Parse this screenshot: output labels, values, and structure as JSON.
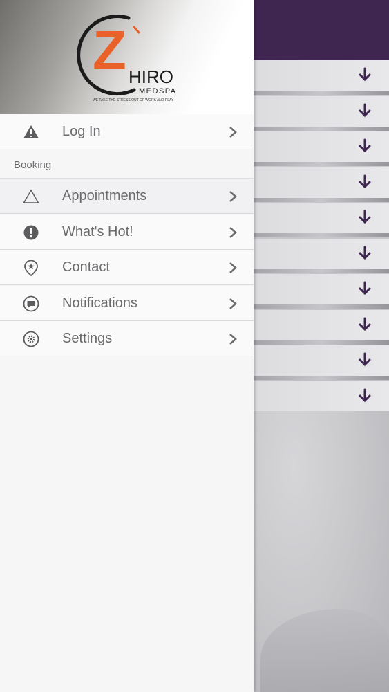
{
  "brand": {
    "letter": "Z",
    "name_rest": "HIRO",
    "sub": "MEDSPA",
    "tagline": "WE TAKE THE STRESS OUT OF WORK AND PLAY",
    "accent_color": "#e8622a",
    "header_color": "#3f2650"
  },
  "menu": {
    "login": {
      "label": "Log In",
      "icon": "warning-icon"
    },
    "section": "Booking",
    "items": [
      {
        "label": "Appointments",
        "icon": "triangle-icon"
      },
      {
        "label": "What's Hot!",
        "icon": "exclamation-icon"
      },
      {
        "label": "Contact",
        "icon": "location-pin-icon"
      },
      {
        "label": "Notifications",
        "icon": "chat-bubble-icon"
      },
      {
        "label": "Settings",
        "icon": "gear-icon"
      }
    ]
  }
}
